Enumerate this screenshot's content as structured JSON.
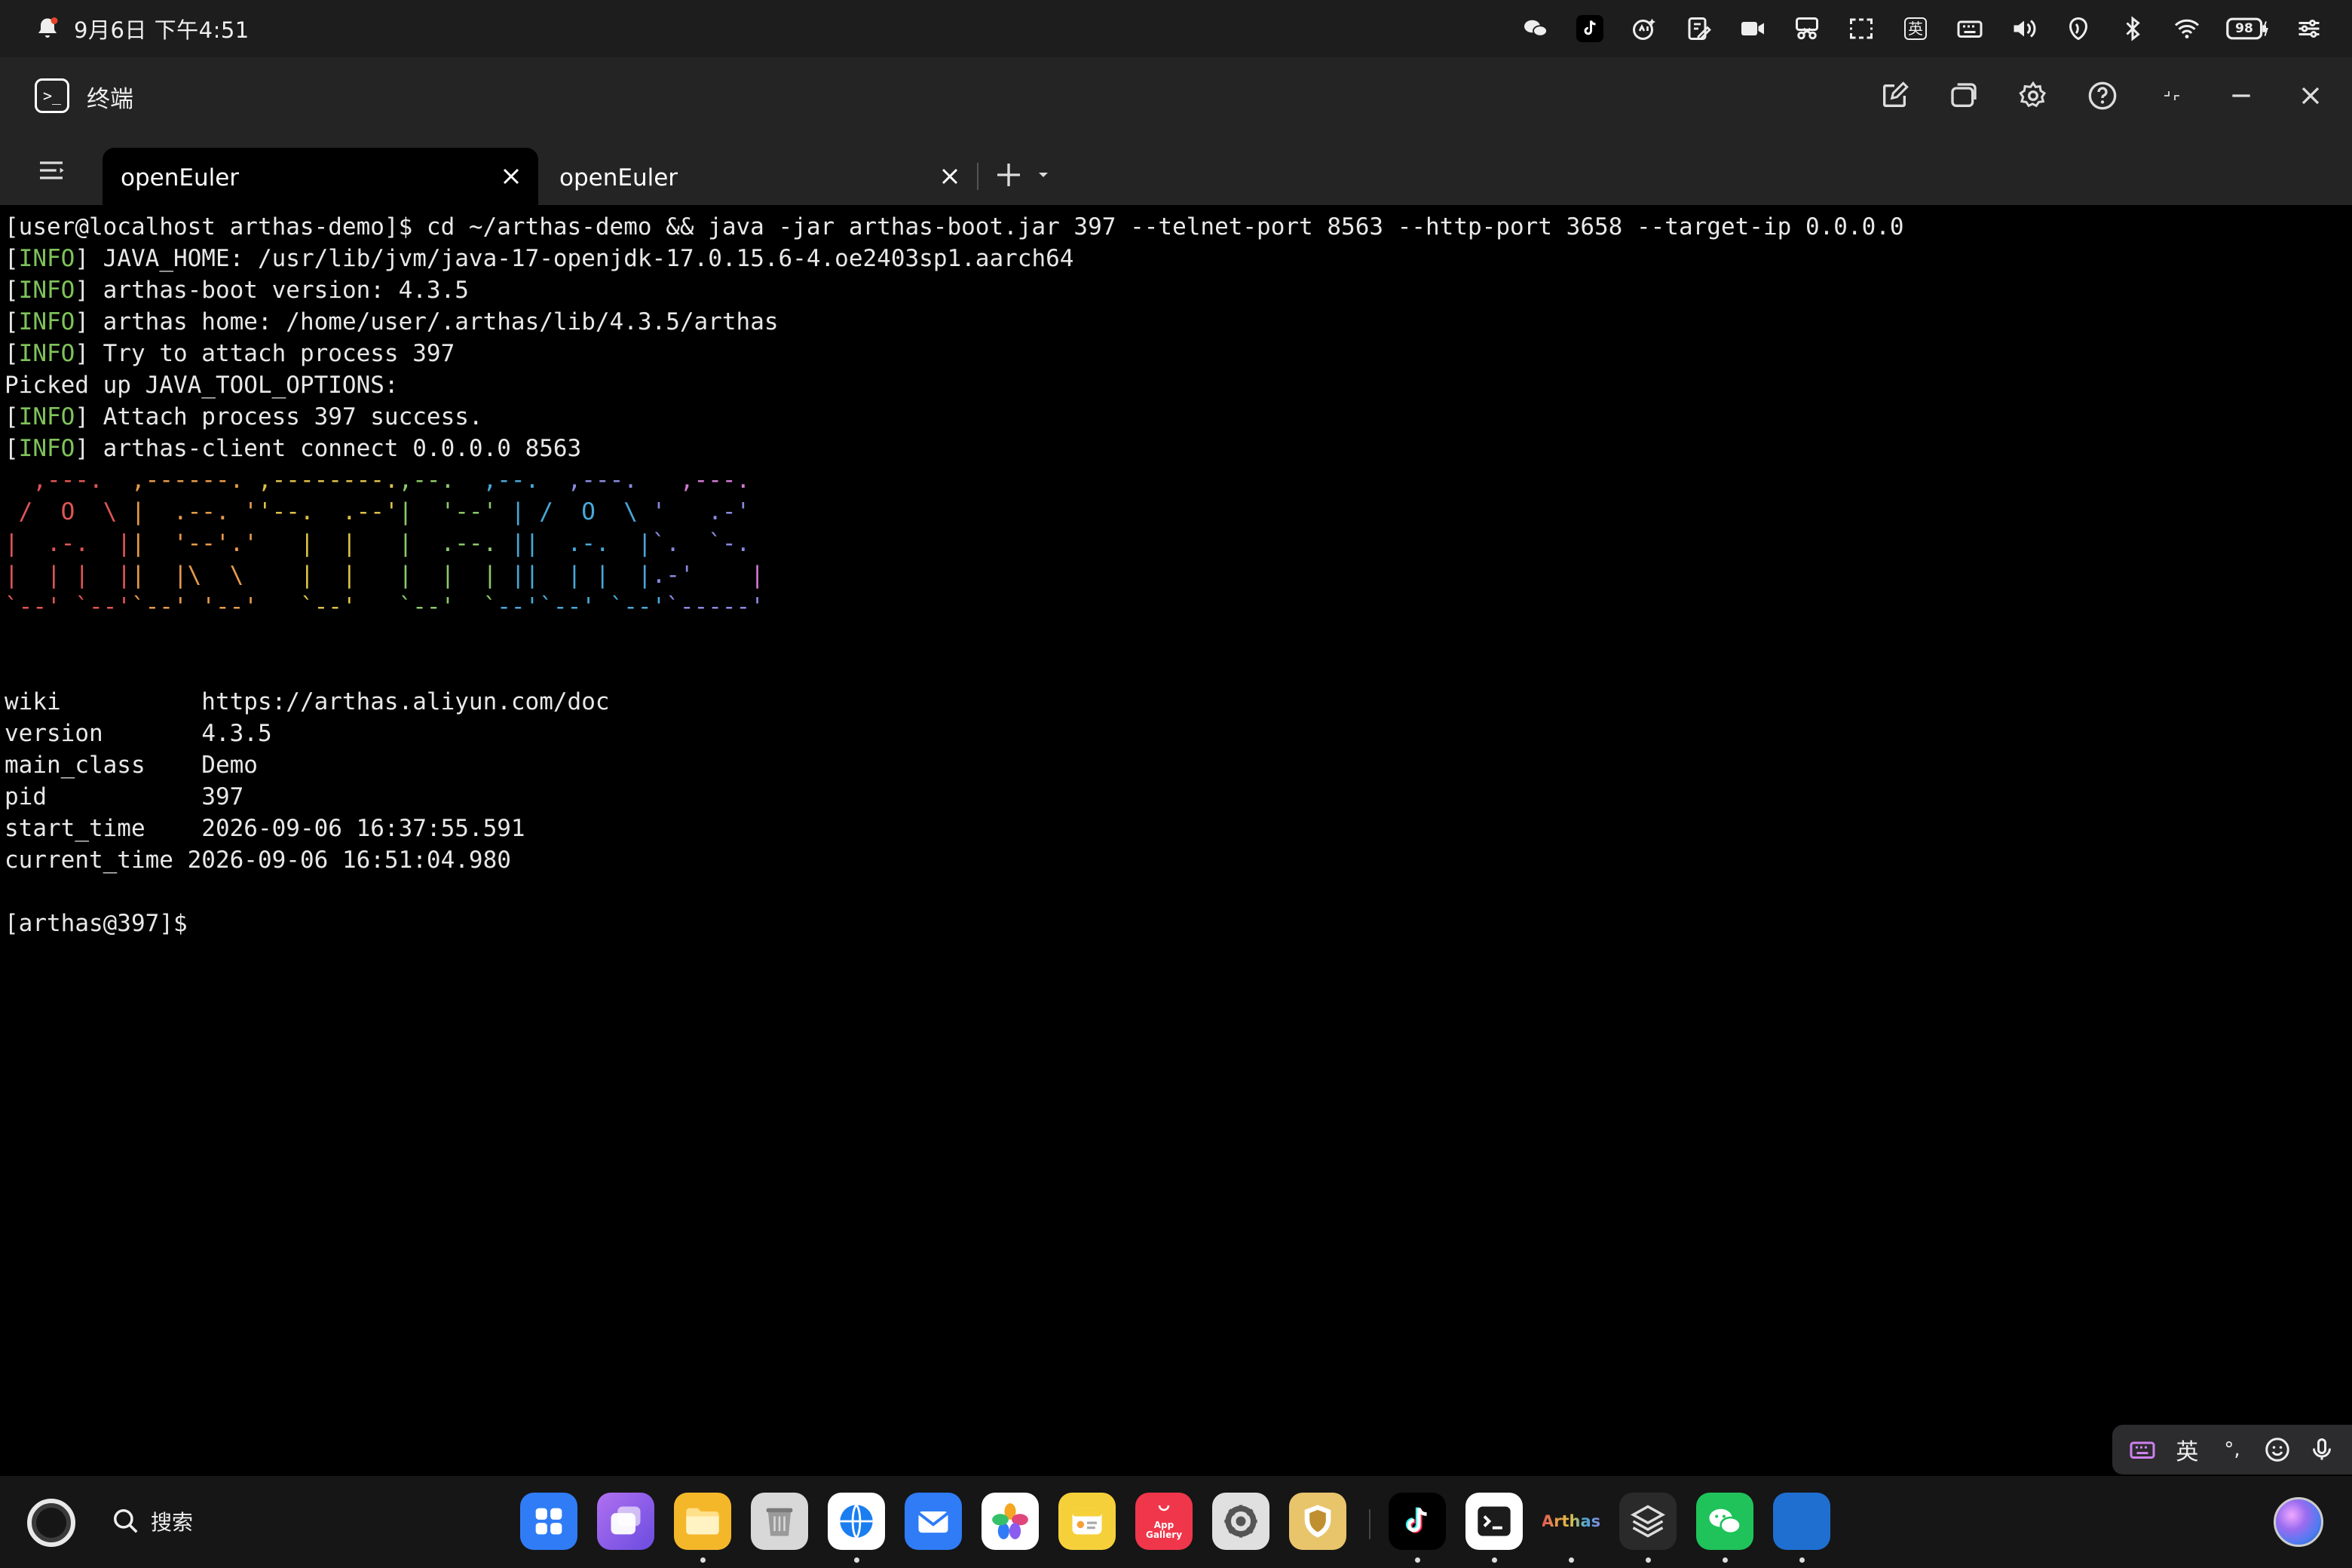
{
  "status_bar": {
    "datetime": "9月6日 下午4:51",
    "ime_badge": "英",
    "battery": "98"
  },
  "window": {
    "title": "终端"
  },
  "tabs": [
    {
      "label": "openEuler",
      "active": true
    },
    {
      "label": "openEuler",
      "active": false
    }
  ],
  "terminal": {
    "command_line": "[user@localhost arthas-demo]$ cd ~/arthas-demo && java -jar arthas-boot.jar 397 --telnet-port 8563 --http-port 3658 --target-ip 0.0.0.0",
    "info_tag": "[INFO]",
    "log_lines": [
      {
        "info": true,
        "text": " JAVA_HOME: /usr/lib/jvm/java-17-openjdk-17.0.15.6-4.oe2403sp1.aarch64"
      },
      {
        "info": true,
        "text": " arthas-boot version: 4.3.5"
      },
      {
        "info": true,
        "text": " arthas home: /home/user/.arthas/lib/4.3.5/arthas"
      },
      {
        "info": true,
        "text": " Try to attach process 397"
      },
      {
        "info": false,
        "text": "Picked up JAVA_TOOL_OPTIONS:"
      },
      {
        "info": true,
        "text": " Attach process 397 success."
      },
      {
        "info": true,
        "text": " arthas-client connect 0.0.0.0 8563"
      }
    ],
    "banner": {
      "wiki_key": "wiki",
      "wiki_val": "https://arthas.aliyun.com/doc",
      "version_key": "version",
      "version_val": "4.3.5",
      "main_class_key": "main_class",
      "main_class_val": "Demo",
      "pid_key": "pid",
      "pid_val": "397",
      "start_time_key": "start_time",
      "start_time_val": "2026-09-06 16:37:55.591",
      "current_time_key": "current_time",
      "current_time_val": "2026-09-06 16:51:04.980"
    },
    "prompt": "[arthas@397]$"
  },
  "ime_toolbar": {
    "lang": "英",
    "punct": "°,"
  },
  "dock": {
    "search_label": "搜索",
    "apps": [
      {
        "name": "app-launcher",
        "bg": "#2f7cf6"
      },
      {
        "name": "multitask",
        "bg": "#8a5cf0"
      },
      {
        "name": "files",
        "bg": "#f4b72a"
      },
      {
        "name": "trash",
        "bg": "#d8d8d8"
      },
      {
        "name": "browser",
        "bg": "#ffffff"
      },
      {
        "name": "mail",
        "bg": "#2f7cf6"
      },
      {
        "name": "gallery",
        "bg": "#ffffff"
      },
      {
        "name": "notes",
        "bg": "#f6d03a"
      },
      {
        "name": "app-gallery",
        "bg": "#f0364a",
        "label": "App Gallery"
      },
      {
        "name": "settings",
        "bg": "#e0e0e0"
      },
      {
        "name": "security",
        "bg": "#e8c46a"
      },
      {
        "name": "tiktok",
        "bg": "#000000"
      },
      {
        "name": "terminal",
        "bg": "#ffffff"
      },
      {
        "name": "arthas",
        "bg": "#161616",
        "label": "Arthas"
      },
      {
        "name": "layers",
        "bg": "#2a2a2a"
      },
      {
        "name": "wechat",
        "bg": "#1fc35a"
      },
      {
        "name": "blue-app",
        "bg": "#1f6fd0"
      }
    ]
  }
}
